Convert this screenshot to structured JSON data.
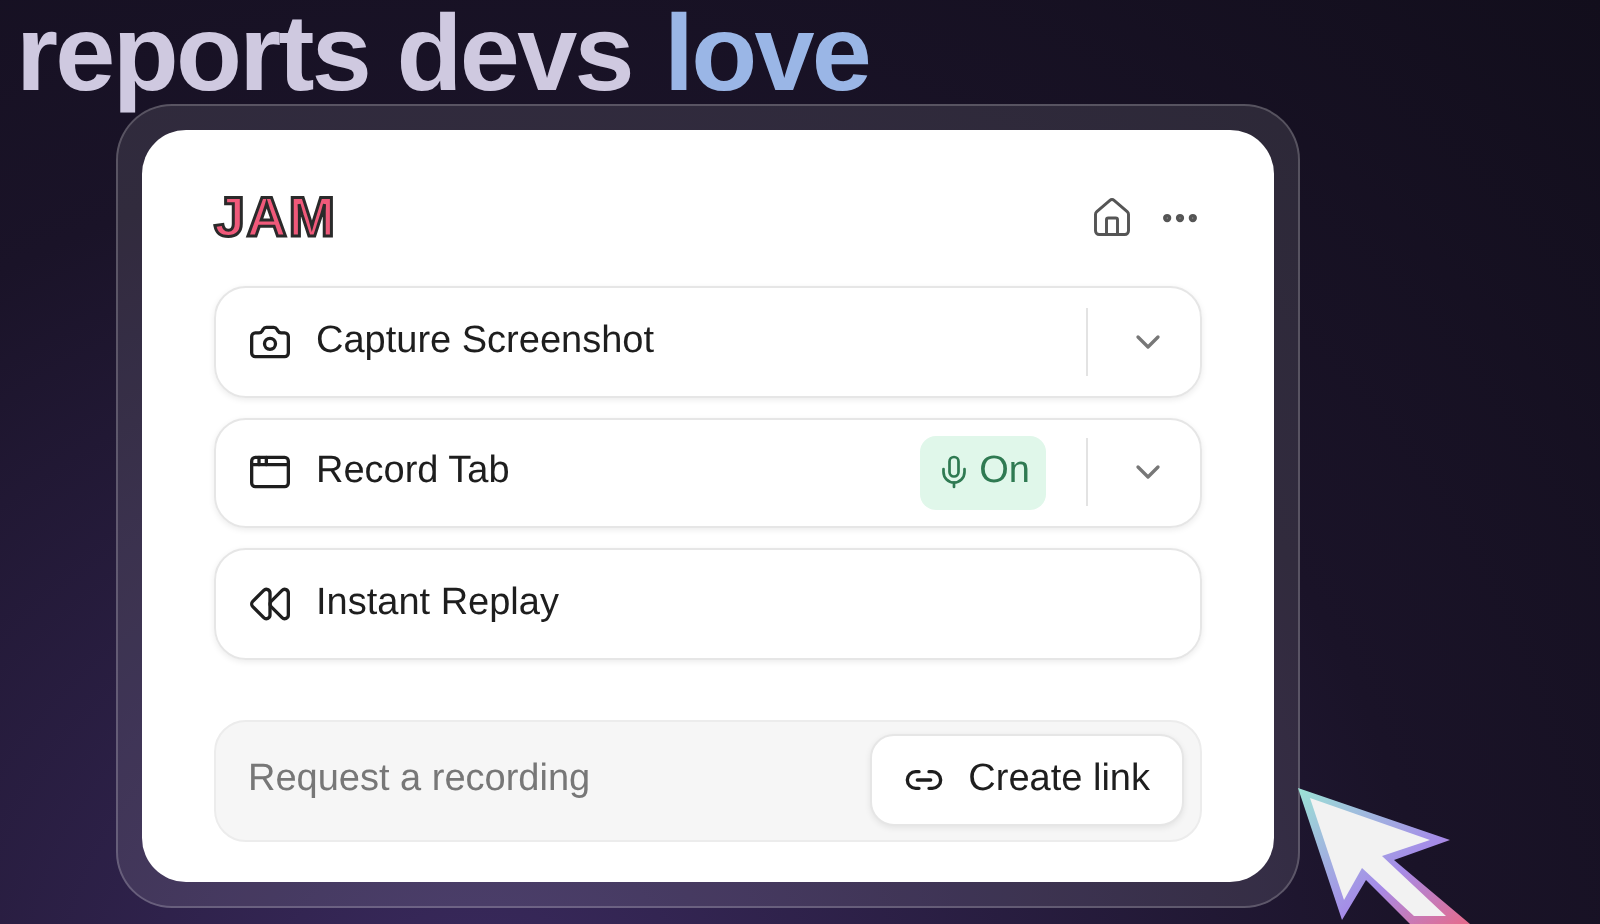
{
  "headline": {
    "text": "reports devs",
    "highlight": "love"
  },
  "panel": {
    "logo": "JAM",
    "actions": [
      {
        "kind": "split",
        "label": "Capture Screenshot"
      },
      {
        "kind": "split",
        "label": "Record Tab",
        "mic": {
          "label": "On",
          "on": true
        }
      },
      {
        "kind": "plain",
        "label": "Instant Replay"
      }
    ],
    "request": {
      "placeholder": "Request a recording",
      "button": "Create link"
    }
  }
}
